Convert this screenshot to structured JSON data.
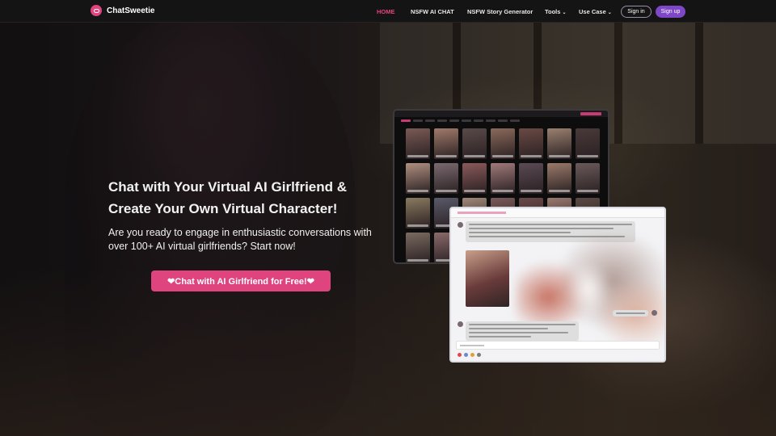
{
  "brand": {
    "name": "ChatSweetie"
  },
  "nav": {
    "home": "HOME",
    "nsfw_chat": "NSFW AI CHAT",
    "story_generator": "NSFW Story Generator",
    "tools": "Tools",
    "use_case": "Use Case",
    "sign_in": "Sign in",
    "sign_up": "Sign up",
    "dropdown_glyph": "⌄"
  },
  "hero": {
    "title_line1": "Chat with Your Virtual AI Girlfriend &",
    "title_line2": "Create Your Own Virtual Character!",
    "subtitle": "Are you ready to engage in enthusiastic conversations with over 100+ AI virtual girlfriends? Start now!",
    "cta": "❤Chat with AI Girlfriend for Free!❤"
  },
  "colors": {
    "accent_pink": "#e0447f",
    "signup_purple": "#7e47c7",
    "navbar_bg": "#151414"
  },
  "mockups": {
    "gallery_card_colors": [
      "#7a5a55",
      "#a07a6a",
      "#5a4a4a",
      "#8a6a5a",
      "#6a4a44",
      "#9a8070",
      "#4a3a3a",
      "#b09080",
      "#7a6a70",
      "#8a5a5a",
      "#a07a7a",
      "#5a4a54",
      "#9a7a6a",
      "#6a5a5a",
      "#8a7a60",
      "#5a5a6a",
      "#a08a7a",
      "#7a5a5a",
      "#6a4a4a",
      "#9a7a70",
      "#5a4a44",
      "#7a6a60",
      "#8a6a6a",
      "#6a5a64",
      "#a0806a",
      "#7a5a60",
      "#5a4a4a",
      "#8a7a70"
    ],
    "chat_avatar_dot_colors": [
      "#e04a4a",
      "#6a8ad0",
      "#e0a040",
      "#7a7a7a"
    ]
  }
}
